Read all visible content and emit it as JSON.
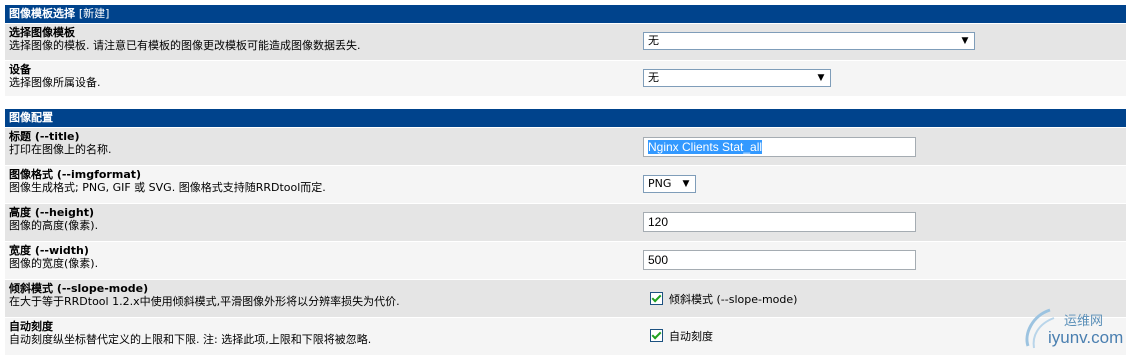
{
  "section1": {
    "title": "图像模板选择",
    "subtitle": "[新建]",
    "rows": [
      {
        "title": "选择图像模板",
        "desc": "选择图像的模板. 请注意已有模板的图像更改模板可能造成图像数据丢失.",
        "value": "无"
      },
      {
        "title": "设备",
        "desc": "选择图像所属设备.",
        "value": "无"
      }
    ]
  },
  "section2": {
    "title": "图像配置",
    "rows": [
      {
        "title": "标题 (--title)",
        "desc": "打印在图像上的名称.",
        "value": "Nginx Clients Stat_all"
      },
      {
        "title": "图像格式 (--imgformat)",
        "desc": "图像生成格式; PNG, GIF 或 SVG. 图像格式支持随RRDtool而定.",
        "value": "PNG"
      },
      {
        "title": "高度 (--height)",
        "desc": "图像的高度(像素).",
        "value": "120"
      },
      {
        "title": "宽度 (--width)",
        "desc": "图像的宽度(像素).",
        "value": "500"
      },
      {
        "title": "倾斜模式 (--slope-mode)",
        "desc": "在大于等于RRDtool 1.2.x中使用倾斜模式,平滑图像外形将以分辨率损失为代价.",
        "checkbox_label": "倾斜模式 (--slope-mode)",
        "checked": true
      },
      {
        "title": "自动刻度",
        "desc": "自动刻度纵坐标替代定义的上限和下限. 注: 选择此项,上限和下限将被忽略.",
        "checkbox_label": "自动刻度",
        "checked": true
      }
    ]
  },
  "watermark": {
    "line1": "运维网",
    "line2": "iyunv.com"
  },
  "colors": {
    "header": "#00438C",
    "row_odd": "#E5E5E5",
    "row_even": "#F5F5F5"
  },
  "icons": [
    "dropdown-arrow-icon",
    "checkbox-checked-icon"
  ]
}
